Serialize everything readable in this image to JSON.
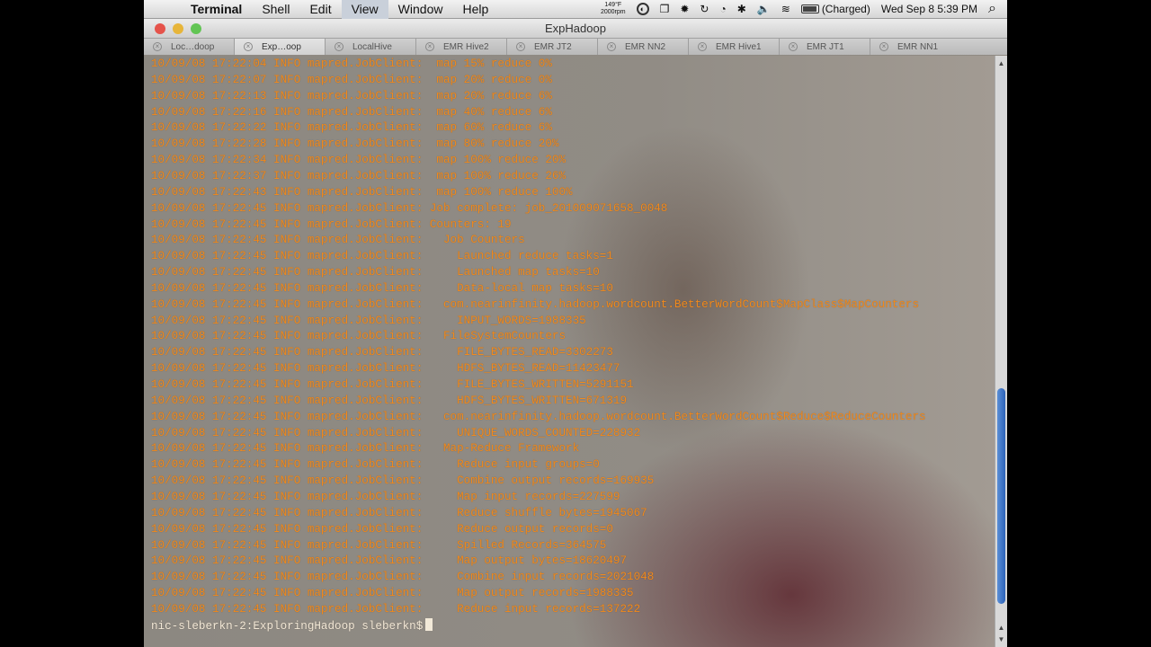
{
  "menubar": {
    "apple": "",
    "app_name": "Terminal",
    "menus": [
      "Shell",
      "Edit",
      "View",
      "Window",
      "Help"
    ],
    "temp_top": "149°F",
    "temp_bottom": "2000rpm",
    "battery_status": "(Charged)",
    "clock": "Wed Sep 8  5:39 PM",
    "search_icon": "⌕"
  },
  "window": {
    "title": "ExpHadoop"
  },
  "tabs": [
    {
      "label": "Loc…doop"
    },
    {
      "label": "Exp…oop"
    },
    {
      "label": "LocalHive"
    },
    {
      "label": "EMR Hive2"
    },
    {
      "label": "EMR JT2"
    },
    {
      "label": "EMR NN2"
    },
    {
      "label": "EMR Hive1"
    },
    {
      "label": "EMR JT1"
    },
    {
      "label": "EMR NN1"
    }
  ],
  "terminal": {
    "lines": [
      "10/09/08 17:22:04 INFO mapred.JobClient:  map 15% reduce 0%",
      "10/09/08 17:22:07 INFO mapred.JobClient:  map 20% reduce 0%",
      "10/09/08 17:22:13 INFO mapred.JobClient:  map 20% reduce 6%",
      "10/09/08 17:22:16 INFO mapred.JobClient:  map 40% reduce 6%",
      "10/09/08 17:22:22 INFO mapred.JobClient:  map 60% reduce 6%",
      "10/09/08 17:22:28 INFO mapred.JobClient:  map 80% reduce 20%",
      "10/09/08 17:22:34 INFO mapred.JobClient:  map 100% reduce 20%",
      "10/09/08 17:22:37 INFO mapred.JobClient:  map 100% reduce 26%",
      "10/09/08 17:22:43 INFO mapred.JobClient:  map 100% reduce 100%",
      "10/09/08 17:22:45 INFO mapred.JobClient: Job complete: job_201009071658_0048",
      "10/09/08 17:22:45 INFO mapred.JobClient: Counters: 19",
      "10/09/08 17:22:45 INFO mapred.JobClient:   Job Counters ",
      "10/09/08 17:22:45 INFO mapred.JobClient:     Launched reduce tasks=1",
      "10/09/08 17:22:45 INFO mapred.JobClient:     Launched map tasks=10",
      "10/09/08 17:22:45 INFO mapred.JobClient:     Data-local map tasks=10",
      "10/09/08 17:22:45 INFO mapred.JobClient:   com.nearinfinity.hadoop.wordcount.BetterWordCount$MapClass$MapCounters",
      "10/09/08 17:22:45 INFO mapred.JobClient:     INPUT_WORDS=1988335",
      "10/09/08 17:22:45 INFO mapred.JobClient:   FileSystemCounters",
      "10/09/08 17:22:45 INFO mapred.JobClient:     FILE_BYTES_READ=3302273",
      "10/09/08 17:22:45 INFO mapred.JobClient:     HDFS_BYTES_READ=11423477",
      "10/09/08 17:22:45 INFO mapred.JobClient:     FILE_BYTES_WRITTEN=5291151",
      "10/09/08 17:22:45 INFO mapred.JobClient:     HDFS_BYTES_WRITTEN=671319",
      "10/09/08 17:22:45 INFO mapred.JobClient:   com.nearinfinity.hadoop.wordcount.BetterWordCount$Reduce$ReduceCounters",
      "10/09/08 17:22:45 INFO mapred.JobClient:     UNIQUE_WORDS_COUNTED=228932",
      "10/09/08 17:22:45 INFO mapred.JobClient:   Map-Reduce Framework",
      "10/09/08 17:22:45 INFO mapred.JobClient:     Reduce input groups=0",
      "10/09/08 17:22:45 INFO mapred.JobClient:     Combine output records=169935",
      "10/09/08 17:22:45 INFO mapred.JobClient:     Map input records=227599",
      "10/09/08 17:22:45 INFO mapred.JobClient:     Reduce shuffle bytes=1945067",
      "10/09/08 17:22:45 INFO mapred.JobClient:     Reduce output records=0",
      "10/09/08 17:22:45 INFO mapred.JobClient:     Spilled Records=364575",
      "10/09/08 17:22:45 INFO mapred.JobClient:     Map output bytes=18620497",
      "10/09/08 17:22:45 INFO mapred.JobClient:     Combine input records=2021048",
      "10/09/08 17:22:45 INFO mapred.JobClient:     Map output records=1988335",
      "10/09/08 17:22:45 INFO mapred.JobClient:     Reduce input records=137222"
    ],
    "prompt": "nic-sleberkn-2:ExploringHadoop sleberkn$"
  },
  "colors": {
    "terminal_text": "#f08a1e",
    "scroll_thumb": "#3a73c9"
  }
}
